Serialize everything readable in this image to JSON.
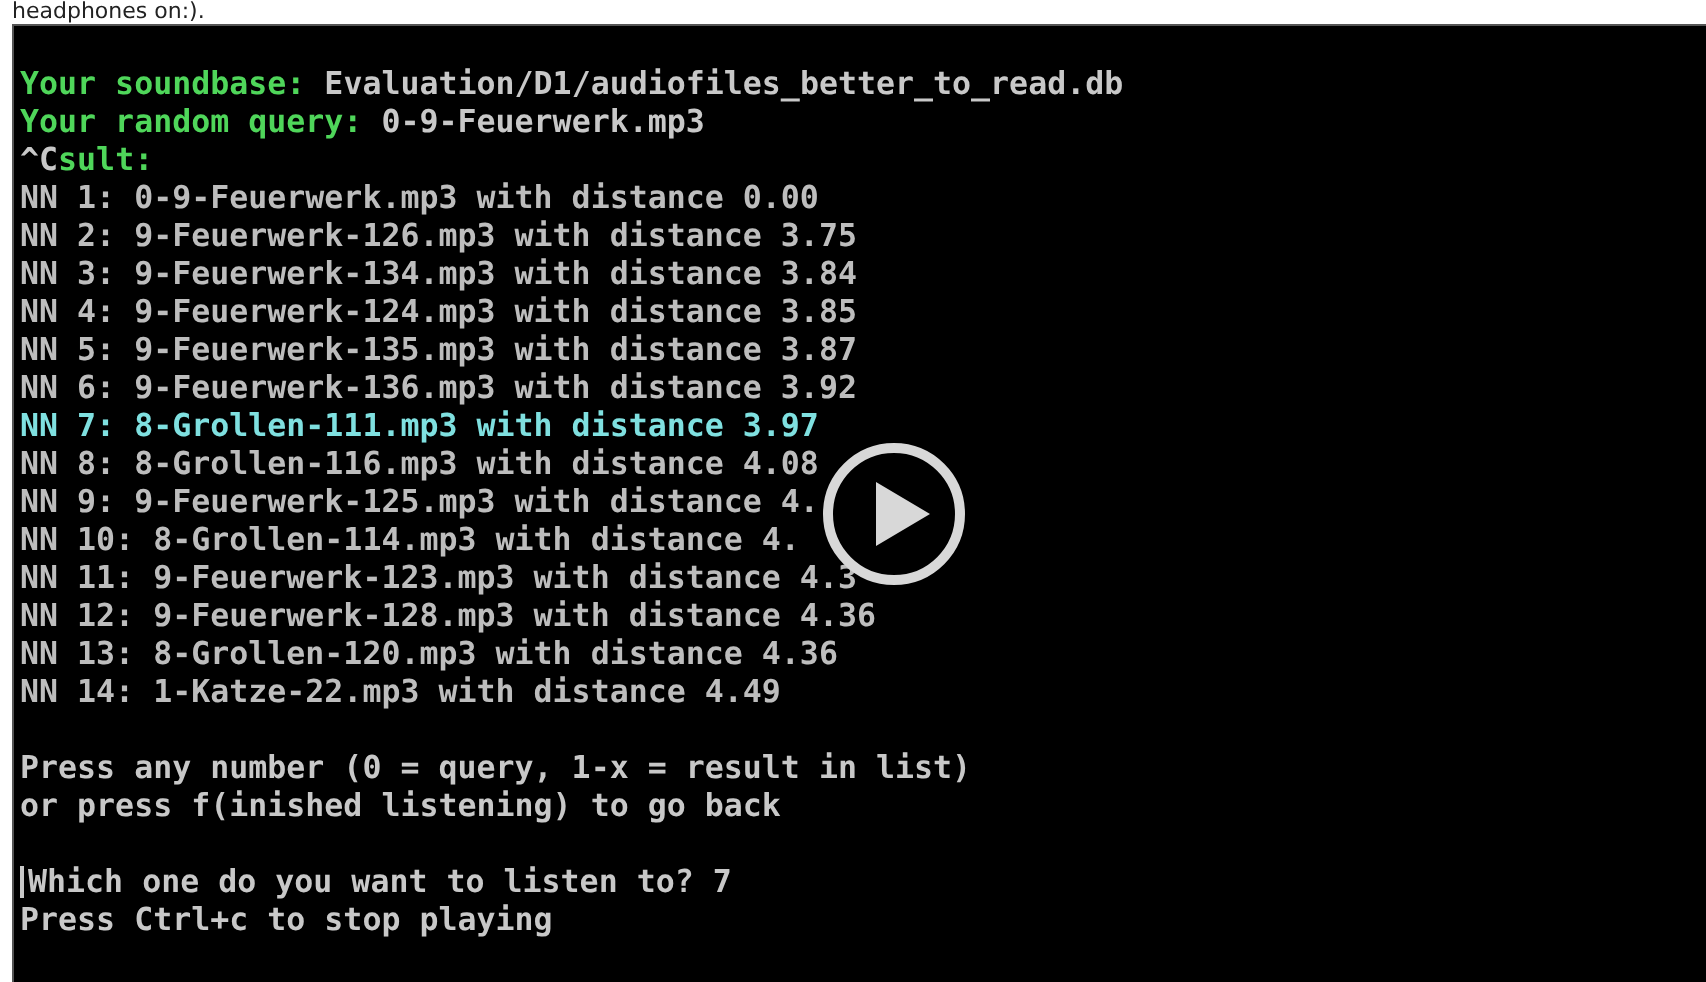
{
  "caption": "headphones on:).",
  "terminal": {
    "lines": [
      {
        "kind": "field",
        "label": "Your soundbase:",
        "value": "Evaluation/D1/audiofiles_better_to_read.db"
      },
      {
        "kind": "field",
        "label": "Your random query:",
        "value": "0-9-Feuerwerk.mp3"
      },
      {
        "kind": "heading",
        "prefix": "^C",
        "label": "sult:"
      },
      {
        "kind": "result",
        "text": "NN 1: 0-9-Feuerwerk.mp3 with distance 0.00",
        "selected": false
      },
      {
        "kind": "result",
        "text": "NN 2: 9-Feuerwerk-126.mp3 with distance 3.75",
        "selected": false
      },
      {
        "kind": "result",
        "text": "NN 3: 9-Feuerwerk-134.mp3 with distance 3.84",
        "selected": false
      },
      {
        "kind": "result",
        "text": "NN 4: 9-Feuerwerk-124.mp3 with distance 3.85",
        "selected": false
      },
      {
        "kind": "result",
        "text": "NN 5: 9-Feuerwerk-135.mp3 with distance 3.87",
        "selected": false
      },
      {
        "kind": "result",
        "text": "NN 6: 9-Feuerwerk-136.mp3 with distance 3.92",
        "selected": false
      },
      {
        "kind": "result",
        "text": "NN 7: 8-Grollen-111.mp3 with distance 3.97",
        "selected": true
      },
      {
        "kind": "result",
        "text": "NN 8: 8-Grollen-116.mp3 with distance 4.08",
        "selected": false
      },
      {
        "kind": "result",
        "text": "NN 9: 9-Feuerwerk-125.mp3 with distance 4.",
        "selected": false
      },
      {
        "kind": "result",
        "text": "NN 10: 8-Grollen-114.mp3 with distance 4.",
        "selected": false
      },
      {
        "kind": "result",
        "text": "NN 11: 9-Feuerwerk-123.mp3 with distance 4.3",
        "selected": false
      },
      {
        "kind": "result",
        "text": "NN 12: 9-Feuerwerk-128.mp3 with distance 4.36",
        "selected": false
      },
      {
        "kind": "result",
        "text": "NN 13: 8-Grollen-120.mp3 with distance 4.36",
        "selected": false
      },
      {
        "kind": "result",
        "text": "NN 14: 1-Katze-22.mp3 with distance 4.49",
        "selected": false
      },
      {
        "kind": "blank"
      },
      {
        "kind": "text",
        "text": "Press any number (0 = query, 1-x = result in list)"
      },
      {
        "kind": "text",
        "text": "or press f(inished listening) to go back"
      },
      {
        "kind": "blank"
      },
      {
        "kind": "prompt",
        "text": "Which one do you want to listen to? 7"
      },
      {
        "kind": "text",
        "text": "Press Ctrl+c to stop playing"
      }
    ]
  }
}
